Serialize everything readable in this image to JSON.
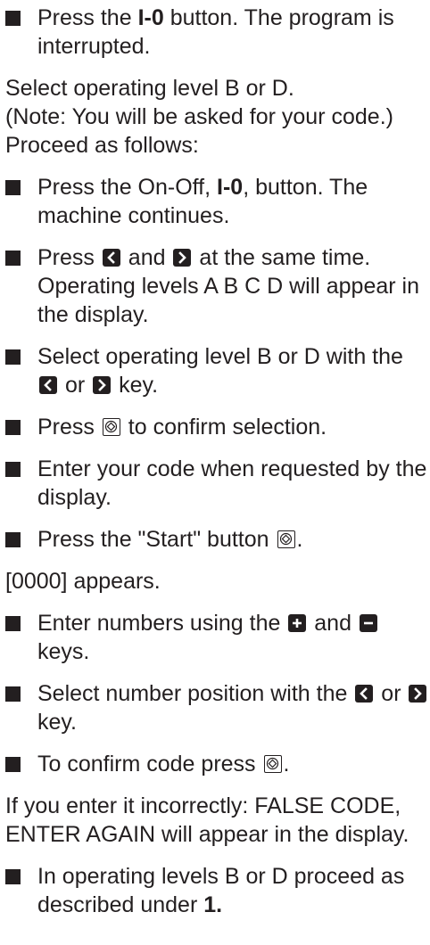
{
  "items": {
    "i1": {
      "before": "Press the ",
      "bold": "I-0",
      "after": " button. The program is interrupted."
    },
    "p1": "Select operating level B or D.",
    "p2": "(Note: You will be asked for your code.)",
    "p3": "Proceed as follows:",
    "i2": {
      "before": "Press the On-Off, ",
      "bold": "I-0",
      "after": ", button. The machine continues."
    },
    "i3": {
      "a": "Press ",
      "b": " and ",
      "c": " at the same time. Operating levels A B C D will appear in the display."
    },
    "i4": {
      "a": "Select operating level B or D with the ",
      "b": " or ",
      "c": " key."
    },
    "i5": {
      "a": "Press ",
      "b": " to confirm selection."
    },
    "i6": "Enter your code when requested by the display.",
    "i7": {
      "a": "Press the \"Start\" button ",
      "b": "."
    },
    "p4": "[0000] appears.",
    "i8": {
      "a": "Enter numbers using the ",
      "b": " and ",
      "c": " keys."
    },
    "i9": {
      "a": "Select number position with the ",
      "b": " or ",
      "c": " key."
    },
    "i10": {
      "a": "To confirm code press ",
      "b": "."
    },
    "p5": "If you enter it incorrectly: FALSE CODE, ENTER AGAIN will appear in the display.",
    "i11": {
      "a": "In operating levels B or D proceed as described under ",
      "bold": "1."
    }
  },
  "icons": {
    "bullet": "square-bullet-icon",
    "left": "left-arrow-key-icon",
    "right": "right-arrow-key-icon",
    "plus": "plus-key-icon",
    "minus": "minus-key-icon",
    "start": "start-button-icon"
  },
  "colors": {
    "text": "#231f20",
    "background": "#ffffff"
  }
}
